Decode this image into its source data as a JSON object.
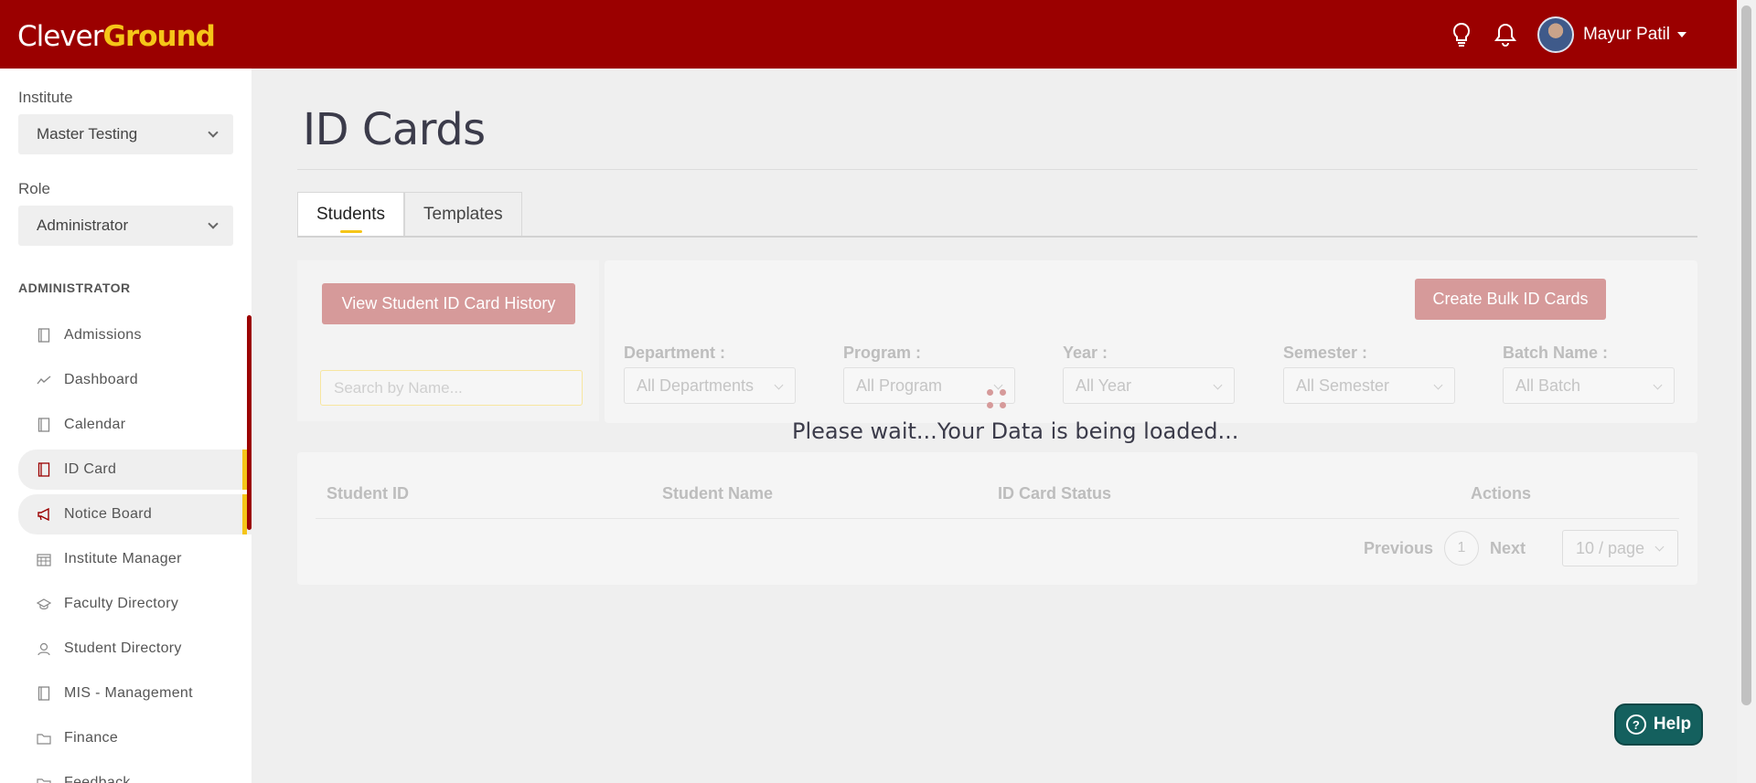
{
  "header": {
    "logo_part1": "Clever",
    "logo_part2": "Ground",
    "user_name": "Mayur Patil",
    "icons": [
      "lightbulb-icon",
      "bell-icon"
    ]
  },
  "sidebar": {
    "institute_label": "Institute",
    "institute_value": "Master Testing",
    "role_label": "Role",
    "role_value": "Administrator",
    "section_heading": "ADMINISTRATOR",
    "items": [
      {
        "label": "Admissions",
        "icon": "book-icon"
      },
      {
        "label": "Dashboard",
        "icon": "trend-icon"
      },
      {
        "label": "Calendar",
        "icon": "book-icon"
      },
      {
        "label": "ID Card",
        "icon": "book-icon"
      },
      {
        "label": "Notice Board",
        "icon": "megaphone-icon"
      },
      {
        "label": "Institute Manager",
        "icon": "calendar-grid-icon"
      },
      {
        "label": "Faculty Directory",
        "icon": "graduation-cap-icon"
      },
      {
        "label": "Student Directory",
        "icon": "users-icon"
      },
      {
        "label": "MIS - Management",
        "icon": "book-icon"
      },
      {
        "label": "Finance",
        "icon": "folder-icon"
      },
      {
        "label": "Feedback",
        "icon": "folder-icon"
      }
    ]
  },
  "main": {
    "title": "ID Cards",
    "tabs": [
      "Students",
      "Templates"
    ],
    "history_button": "View Student ID Card History",
    "search_placeholder": "Search by Name...",
    "bulk_button": "Create Bulk ID Cards",
    "filters": [
      {
        "label": "Department :",
        "value": "All Departments"
      },
      {
        "label": "Program :",
        "value": "All Program"
      },
      {
        "label": "Year :",
        "value": "All Year"
      },
      {
        "label": "Semester :",
        "value": "All Semester"
      },
      {
        "label": "Batch Name :",
        "value": "All Batch"
      }
    ],
    "loading_text": "Please wait...Your Data is being loaded...",
    "table_headers": [
      "Student ID",
      "Student Name",
      "ID Card Status",
      "Actions"
    ],
    "pagination": {
      "previous": "Previous",
      "page": "1",
      "next": "Next",
      "page_size": "10 / page"
    }
  },
  "help_button": "Help",
  "colors": {
    "brand_red": "#9b0000",
    "accent_yellow": "#f5c518",
    "help_teal": "#14605e"
  }
}
